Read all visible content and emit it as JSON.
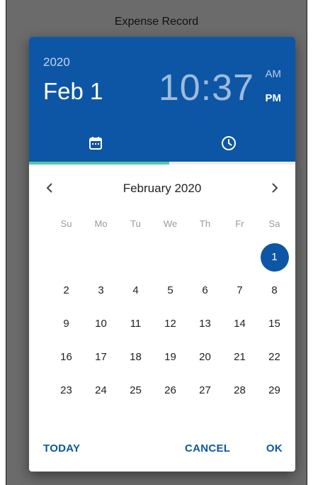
{
  "window": {
    "title": "Expense Record"
  },
  "header": {
    "year": "2020",
    "date": "Feb 1",
    "time": "10:37",
    "am": "AM",
    "pm": "PM"
  },
  "tabs": [
    {
      "name": "date",
      "icon": "calendar-icon",
      "active": true
    },
    {
      "name": "time",
      "icon": "clock-icon",
      "active": false
    }
  ],
  "calendar": {
    "month_label": "February 2020",
    "weekdays": [
      "Su",
      "Mo",
      "Tu",
      "We",
      "Th",
      "Fr",
      "Sa"
    ],
    "days": [
      [
        "",
        "",
        "",
        "",
        "",
        "",
        "1"
      ],
      [
        "2",
        "3",
        "4",
        "5",
        "6",
        "7",
        "8"
      ],
      [
        "9",
        "10",
        "11",
        "12",
        "13",
        "14",
        "15"
      ],
      [
        "16",
        "17",
        "18",
        "19",
        "20",
        "21",
        "22"
      ],
      [
        "23",
        "24",
        "25",
        "26",
        "27",
        "28",
        "29"
      ]
    ],
    "selected_day": "1"
  },
  "actions": {
    "today": "TODAY",
    "cancel": "CANCEL",
    "ok": "OK"
  },
  "colors": {
    "primary": "#0d56a6",
    "tab_indicator": "#55c7a6",
    "frame": "#6b6b6b"
  }
}
